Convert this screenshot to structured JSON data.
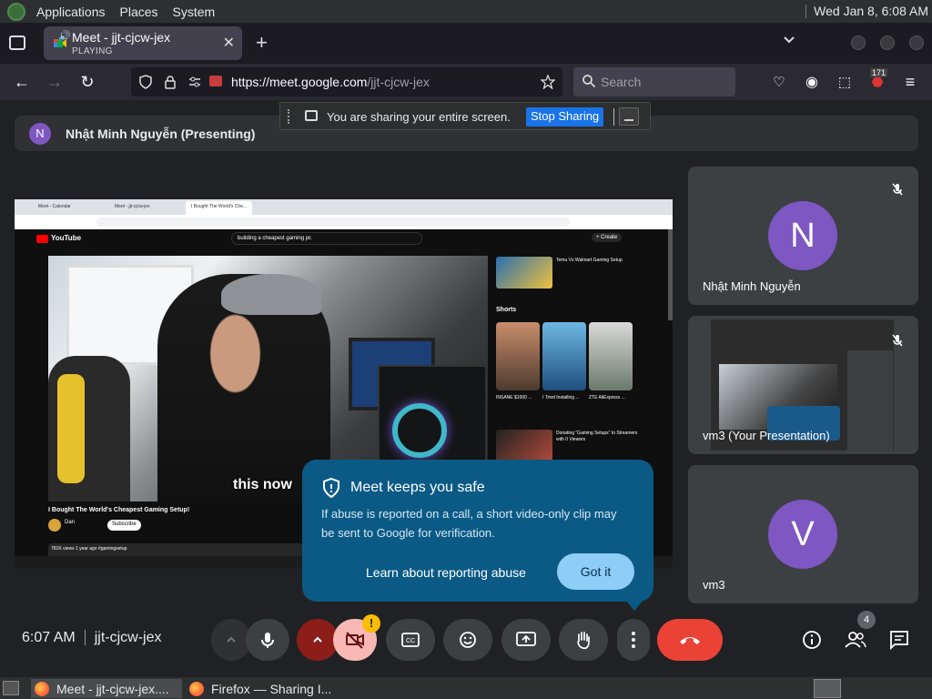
{
  "system_panel": {
    "menus": [
      "Applications",
      "Places",
      "System"
    ],
    "clock": "Wed Jan  8,  6:08 AM"
  },
  "browser": {
    "tab": {
      "title": "Meet - jjt-cjcw-jex",
      "subtitle": "PLAYING"
    },
    "url_host": "https://meet.google.com",
    "url_path": "/jjt-cjcw-jex",
    "search_placeholder": "Search",
    "extension_badge": "171"
  },
  "share_notice": {
    "message": "You are sharing your entire screen.",
    "stop_label": "Stop Sharing"
  },
  "presenting_banner": {
    "avatar_letter": "N",
    "name": "Nhật Minh Nguyễn (Presenting)"
  },
  "presentation": {
    "inner_tabs": [
      "Meet - Calendar",
      "Meet - jjt-cjcw-jex",
      "I Bought The World's Che..."
    ],
    "site": "YouTube",
    "query": "building a cheapest gaming pc",
    "create_label": "+ Create",
    "video_caption": "this now",
    "video_title": "I Bought The World's Cheapest Gaming Setup!",
    "channel": "Dan",
    "subscribe_label": "Subscribe",
    "description": "781K views  1 year ago  #gamingsetup",
    "side_videos": [
      {
        "title": "Temu Vs Walmart Gaming Setup"
      },
      {
        "title": "Donating \"Gaming Setups\" to Streamers with 0 Viewers"
      }
    ],
    "shorts_label": "Shorts",
    "shorts": [
      {
        "title": "INSANE $1000 ..."
      },
      {
        "title": "I Tried Installing ..."
      },
      {
        "title": "ZTE AliExpress ..."
      }
    ]
  },
  "tiles": [
    {
      "letter": "N",
      "name": "Nhật Minh Nguyễn"
    },
    {
      "name": "vm3 (Your Presentation)"
    },
    {
      "letter": "V",
      "name": "vm3"
    }
  ],
  "safety_popup": {
    "title": "Meet keeps you safe",
    "body": "If abuse is reported on a call, a short video-only clip may be sent to Google for verification.",
    "learn_link": "Learn about reporting abuse",
    "got_it": "Got it"
  },
  "meeting_bar": {
    "time": "6:07 AM",
    "code": "jjt-cjcw-jex",
    "warning": "!",
    "people_count": "4"
  },
  "taskbar": {
    "items": [
      "Meet - jjt-cjcw-jex....",
      "Firefox — Sharing I..."
    ]
  },
  "colors": {
    "meet_bg": "#202124",
    "popup_bg": "#0b5a85",
    "end_call": "#ea4335",
    "avatar_purple": "#7e57c2"
  }
}
